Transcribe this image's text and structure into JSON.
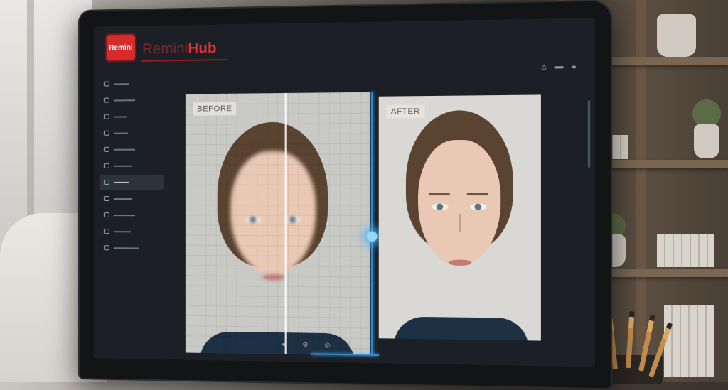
{
  "app": {
    "logo_text": "Remini",
    "brand_part1": "Remini",
    "brand_part2": "Hub"
  },
  "header": {
    "icons": [
      "home-icon",
      "menu-icon"
    ]
  },
  "sidebar": {
    "items": [
      {
        "icon": "square-icon"
      },
      {
        "icon": "square-icon"
      },
      {
        "icon": "square-icon"
      },
      {
        "icon": "square-icon"
      },
      {
        "icon": "square-icon"
      },
      {
        "icon": "square-icon"
      },
      {
        "icon": "square-icon",
        "active": true
      },
      {
        "icon": "square-icon"
      },
      {
        "icon": "square-icon"
      },
      {
        "icon": "square-icon"
      },
      {
        "icon": "square-icon"
      }
    ]
  },
  "compare": {
    "before_label": "BEFORE",
    "after_label": "AFTER"
  },
  "toolbar": {
    "icons": [
      "apple-icon",
      "gear-icon",
      "circle-icon",
      "upload-icon"
    ]
  },
  "colors": {
    "brand_red": "#e0322f",
    "accent_blue": "#2f8fd0"
  }
}
